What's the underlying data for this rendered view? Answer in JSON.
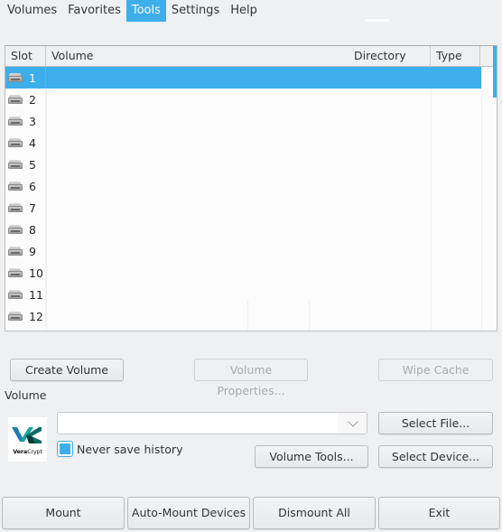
{
  "menu": {
    "items": [
      {
        "label": "Volumes",
        "active": false
      },
      {
        "label": "Favorites",
        "active": false
      },
      {
        "label": "Tools",
        "active": true
      },
      {
        "label": "Settings",
        "active": false
      },
      {
        "label": "Help",
        "active": false
      }
    ]
  },
  "table": {
    "columns": {
      "slot": "Slot",
      "volume": "Volume",
      "directory": "Directory",
      "type": "Type"
    },
    "rows": [
      {
        "slot": "1",
        "volume": "",
        "directory": "",
        "type": "",
        "selected": true,
        "icon": "drive-icon"
      },
      {
        "slot": "2",
        "volume": "",
        "directory": "",
        "type": "",
        "selected": false,
        "icon": "drive-icon"
      },
      {
        "slot": "3",
        "volume": "",
        "directory": "",
        "type": "",
        "selected": false,
        "icon": "drive-icon"
      },
      {
        "slot": "4",
        "volume": "",
        "directory": "",
        "type": "",
        "selected": false,
        "icon": "drive-icon"
      },
      {
        "slot": "5",
        "volume": "",
        "directory": "",
        "type": "",
        "selected": false,
        "icon": "drive-icon"
      },
      {
        "slot": "6",
        "volume": "",
        "directory": "",
        "type": "",
        "selected": false,
        "icon": "drive-icon"
      },
      {
        "slot": "7",
        "volume": "",
        "directory": "",
        "type": "",
        "selected": false,
        "icon": "drive-icon"
      },
      {
        "slot": "8",
        "volume": "",
        "directory": "",
        "type": "",
        "selected": false,
        "icon": "drive-icon"
      },
      {
        "slot": "9",
        "volume": "",
        "directory": "",
        "type": "",
        "selected": false,
        "icon": "drive-icon"
      },
      {
        "slot": "10",
        "volume": "",
        "directory": "",
        "type": "",
        "selected": false,
        "icon": "drive-icon"
      },
      {
        "slot": "11",
        "volume": "",
        "directory": "",
        "type": "",
        "selected": false,
        "icon": "drive-icon"
      },
      {
        "slot": "12",
        "volume": "",
        "directory": "",
        "type": "",
        "selected": false,
        "icon": "drive-icon"
      }
    ]
  },
  "actions": {
    "create_volume": "Create Volume",
    "volume_properties": "Volume Properties...",
    "wipe_cache": "Wipe Cache"
  },
  "volume_section": {
    "label": "Volume",
    "logo": {
      "brand_bold": "Vera",
      "brand_regular": "Crypt"
    },
    "path_value": "",
    "never_save_history_label": "Never save history",
    "never_save_history_checked": true,
    "select_file": "Select File...",
    "volume_tools": "Volume Tools...",
    "select_device": "Select Device..."
  },
  "bottom": {
    "mount": "Mount",
    "auto_mount": "Auto-Mount Devices",
    "dismount_all": "Dismount All",
    "exit": "Exit"
  },
  "colors": {
    "accent": "#3daee9",
    "window_bg": "#eff0f1",
    "view_bg": "#fcfcfc"
  }
}
